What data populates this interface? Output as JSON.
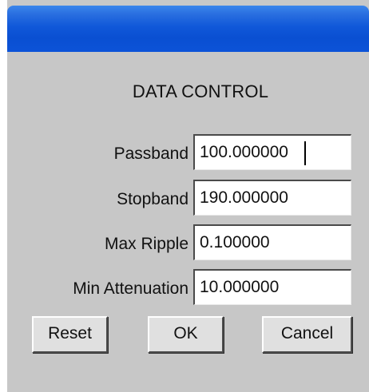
{
  "dialog": {
    "heading": "DATA CONTROL",
    "fields": [
      {
        "label": "Passband",
        "value": "100.000000"
      },
      {
        "label": "Stopband",
        "value": "190.000000"
      },
      {
        "label": "Max Ripple",
        "value": "0.100000"
      },
      {
        "label": "Min Attenuation",
        "value": "10.000000"
      }
    ],
    "buttons": {
      "reset": "Reset",
      "ok": "OK",
      "cancel": "Cancel"
    }
  },
  "colors": {
    "titlebar": "#0a4fd2",
    "background": "#c7c7c7"
  }
}
